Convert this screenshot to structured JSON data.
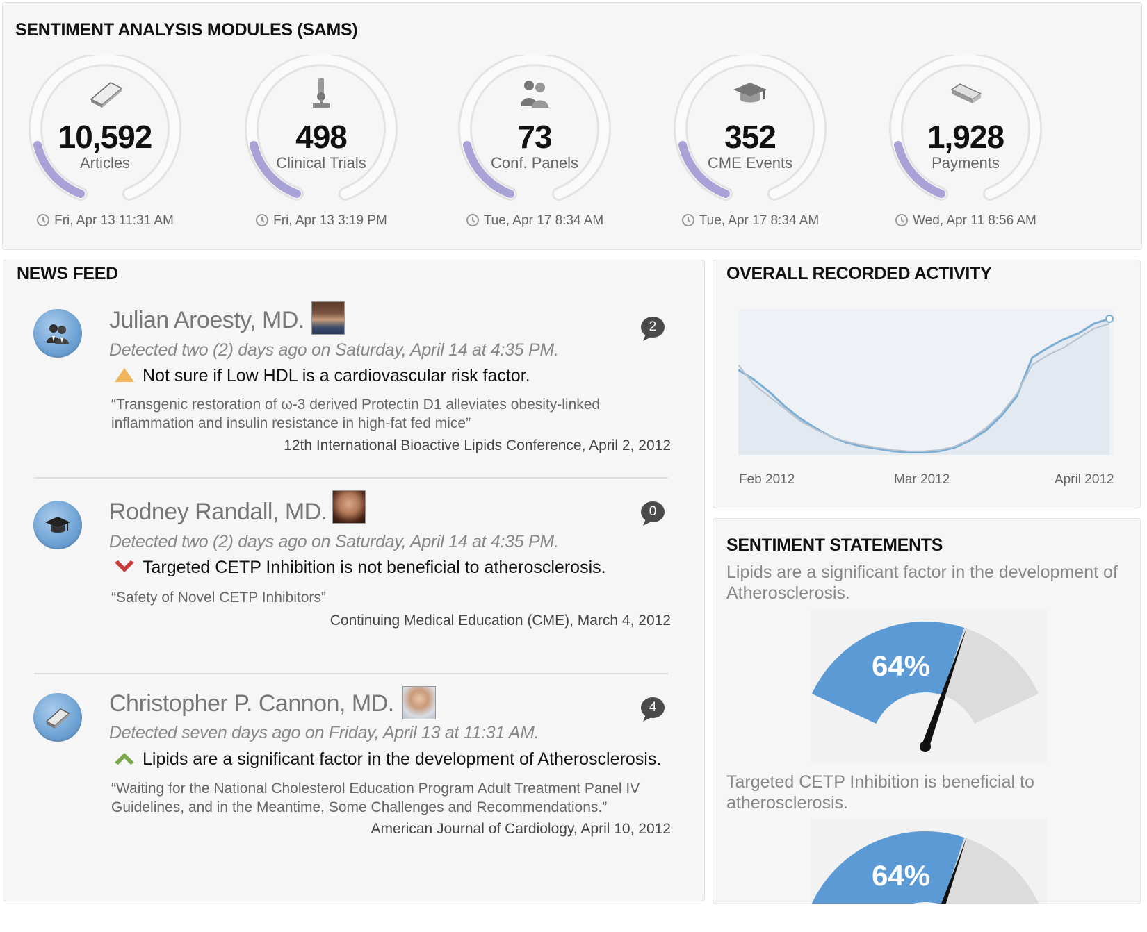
{
  "sams": {
    "title": "SENTIMENT ANALYSIS MODULES (SAMS)",
    "modules": [
      {
        "value": "10,592",
        "label": "Articles",
        "time": "Fri, Apr 13 11:31 AM",
        "icon": "book-icon"
      },
      {
        "value": "498",
        "label": "Clinical Trials",
        "time": "Fri, Apr 13 3:19 PM",
        "icon": "microscope-icon"
      },
      {
        "value": "73",
        "label": "Conf. Panels",
        "time": "Tue, Apr 17 8:34 AM",
        "icon": "people-icon"
      },
      {
        "value": "352",
        "label": "CME Events",
        "time": "Tue, Apr 17 8:34 AM",
        "icon": "graduation-cap-icon"
      },
      {
        "value": "1,928",
        "label": "Payments",
        "time": "Wed, Apr 11 8:56 AM",
        "icon": "payment-icon"
      }
    ],
    "accent_color": "#a8a2d6"
  },
  "news": {
    "title": "NEWS FEED",
    "items": [
      {
        "author": "Julian Aroesty, MD.",
        "comments": "2",
        "detected": "Detected two (2) days ago on Saturday, April 14 at 4:35 PM.",
        "statement": "Not sure if Low HDL is a cardiovascular risk factor.",
        "sentiment_icon": "neutral-triangle-icon",
        "quote": "“Transgenic restoration of ω-3 derived Protectin D1 alleviates obesity-linked inflammation and insulin resistance in high-fat fed mice”",
        "source": "12th International Bioactive Lipids Conference, April 2, 2012",
        "type_icon": "people-icon"
      },
      {
        "author": "Rodney Randall, MD.",
        "comments": "0",
        "detected": "Detected two (2) days ago on Saturday, April 14 at 4:35 PM.",
        "statement": "Targeted CETP Inhibition is not beneficial to atherosclerosis.",
        "sentiment_icon": "negative-chevron-down-icon",
        "quote": "“Safety of Novel CETP Inhibitors”",
        "source": "Continuing Medical Education (CME), March 4, 2012",
        "type_icon": "graduation-cap-icon"
      },
      {
        "author": "Christopher P. Cannon, MD.",
        "comments": "4",
        "detected": "Detected seven days ago on Friday, April 13 at 11:31 AM.",
        "statement": "Lipids are a significant factor in the development of Atherosclerosis.",
        "sentiment_icon": "positive-chevron-up-icon",
        "quote": "“Waiting for the National Cholesterol Education Program Adult Treatment Panel IV Guidelines, and in the Meantime, Some Challenges and Recommendations.”",
        "source": "American Journal of Cardiology, April 10, 2012",
        "type_icon": "book-icon"
      }
    ]
  },
  "activity": {
    "title": "OVERALL RECORDED ACTIVITY",
    "chart_data": {
      "type": "line",
      "x_tick_labels": [
        "Feb 2012",
        "Mar 2012",
        "April 2012"
      ],
      "grid": false,
      "series": [
        {
          "values": [
            70,
            62,
            52,
            40,
            30,
            22,
            15,
            10,
            7,
            5,
            3,
            2,
            2,
            3,
            6,
            12,
            20,
            32,
            48,
            80,
            88,
            95,
            100,
            108,
            112
          ]
        },
        {
          "values": [
            74,
            58,
            48,
            38,
            28,
            21,
            15,
            11,
            8,
            6,
            4,
            3,
            3,
            4,
            7,
            13,
            22,
            34,
            50,
            74,
            82,
            88,
            96,
            104,
            108
          ]
        }
      ],
      "line_color": "#7aaed4",
      "fill_color": "#e3e9f1"
    }
  },
  "sentiment": {
    "title": "SENTIMENT STATEMENTS",
    "gauges": [
      {
        "text": "Lipids are a significant factor in the development of Atherosclerosis.",
        "percent_label": "64%",
        "value": 64
      },
      {
        "text": "Targeted CETP Inhibition is beneficial to atherosclerosis.",
        "percent_label": "64%",
        "value": 64
      }
    ],
    "gauge_fill_color": "#5b9ad4",
    "gauge_rest_color": "#dcdcdc"
  }
}
